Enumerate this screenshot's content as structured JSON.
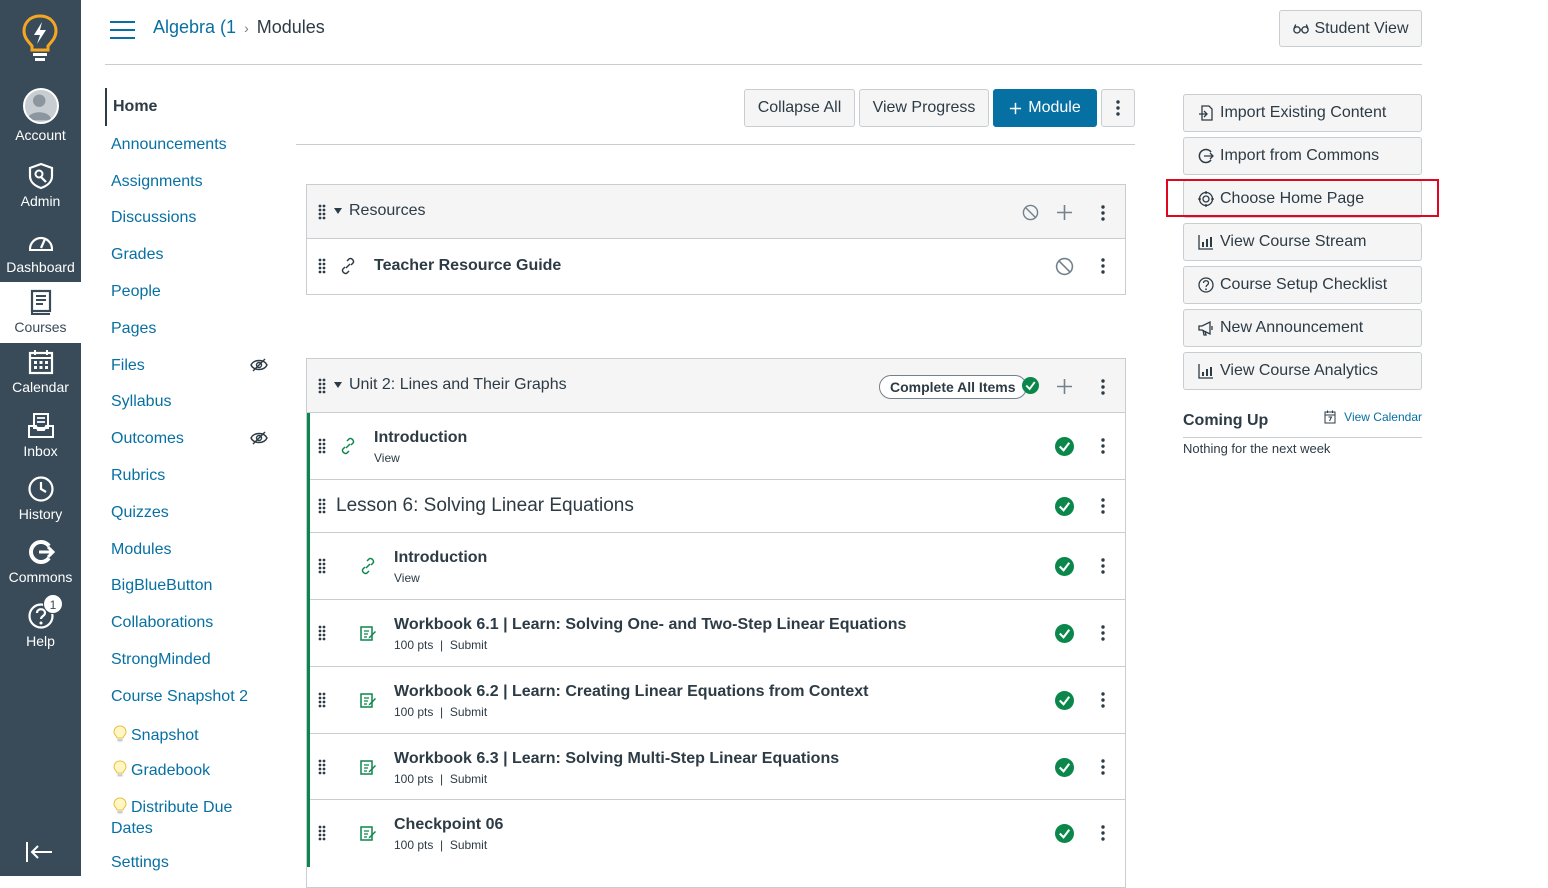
{
  "global_nav": {
    "items": [
      {
        "label": "Account",
        "icon": "account-avatar"
      },
      {
        "label": "Admin",
        "icon": "shield-icon"
      },
      {
        "label": "Dashboard",
        "icon": "dashboard-icon"
      },
      {
        "label": "Courses",
        "icon": "book-icon"
      },
      {
        "label": "Calendar",
        "icon": "calendar-icon"
      },
      {
        "label": "Inbox",
        "icon": "inbox-icon"
      },
      {
        "label": "History",
        "icon": "clock-icon"
      },
      {
        "label": "Commons",
        "icon": "commons-icon"
      },
      {
        "label": "Help",
        "icon": "help-icon"
      }
    ],
    "active": "Courses",
    "help_badge": "1",
    "brand_color": "#394b58",
    "logo_color": "#f5a623"
  },
  "header": {
    "breadcrumb_course": "Algebra (1",
    "breadcrumb_separator": "›",
    "breadcrumb_page": "Modules",
    "student_view_label": "Student View"
  },
  "course_nav": {
    "items": [
      {
        "label": "Home",
        "active": true
      },
      {
        "label": "Announcements"
      },
      {
        "label": "Assignments"
      },
      {
        "label": "Discussions"
      },
      {
        "label": "Grades"
      },
      {
        "label": "People"
      },
      {
        "label": "Pages"
      },
      {
        "label": "Files",
        "hidden": true
      },
      {
        "label": "Syllabus"
      },
      {
        "label": "Outcomes",
        "hidden": true
      },
      {
        "label": "Rubrics"
      },
      {
        "label": "Quizzes"
      },
      {
        "label": "Modules"
      },
      {
        "label": "BigBlueButton"
      },
      {
        "label": "Collaborations"
      },
      {
        "label": "StrongMinded"
      },
      {
        "label": "Course Snapshot 2"
      },
      {
        "label": "Snapshot",
        "bulb": true
      },
      {
        "label": "Gradebook",
        "bulb": true
      },
      {
        "label": "Distribute Due",
        "label2": "Dates",
        "bulb": true
      },
      {
        "label": "Settings"
      }
    ]
  },
  "toolbar": {
    "collapse_all": "Collapse All",
    "view_progress": "View Progress",
    "add_module": "Module",
    "primary_color": "#0770a3"
  },
  "modules": [
    {
      "title": "Resources",
      "items": [
        {
          "title": "Teacher Resource Guide",
          "type": "link"
        }
      ]
    },
    {
      "title": "Unit 2: Lines and Their Graphs",
      "complete_label": "Complete All Items",
      "items": [
        {
          "title": "Introduction",
          "sub": "View",
          "type": "link"
        },
        {
          "title": "Lesson 6: Solving Linear Equations",
          "type": "header"
        },
        {
          "title": "Introduction",
          "sub": "View",
          "type": "link"
        },
        {
          "title": "Workbook 6.1 | Learn: Solving One- and Two-Step Linear Equations",
          "sub": "100 pts  |  Submit",
          "type": "assignment"
        },
        {
          "title": "Workbook 6.2 | Learn: Creating Linear Equations from Context",
          "sub": "100 pts  |  Submit",
          "type": "assignment"
        },
        {
          "title": "Workbook 6.3 | Learn: Solving Multi-Step Linear Equations",
          "sub": "100 pts  |  Submit",
          "type": "assignment"
        },
        {
          "title": "Checkpoint 06",
          "sub": "100 pts  |  Submit",
          "type": "assignment"
        }
      ]
    }
  ],
  "sidebar": {
    "buttons": [
      {
        "label": "Import Existing Content",
        "icon": "import-icon"
      },
      {
        "label": "Import from Commons",
        "icon": "commons-icon"
      },
      {
        "label": "Choose Home Page",
        "icon": "target-icon"
      },
      {
        "label": "View Course Stream",
        "icon": "stream-icon"
      },
      {
        "label": "Course Setup Checklist",
        "icon": "question-icon"
      },
      {
        "label": "New Announcement",
        "icon": "megaphone-icon"
      },
      {
        "label": "View Course Analytics",
        "icon": "analytics-icon"
      }
    ],
    "coming_up_title": "Coming Up",
    "view_calendar": "View Calendar",
    "nothing_text": "Nothing for the next week",
    "highlight_color": "#e0061f"
  },
  "status_colors": {
    "published": "#0b874b",
    "link": "#0770a3"
  }
}
